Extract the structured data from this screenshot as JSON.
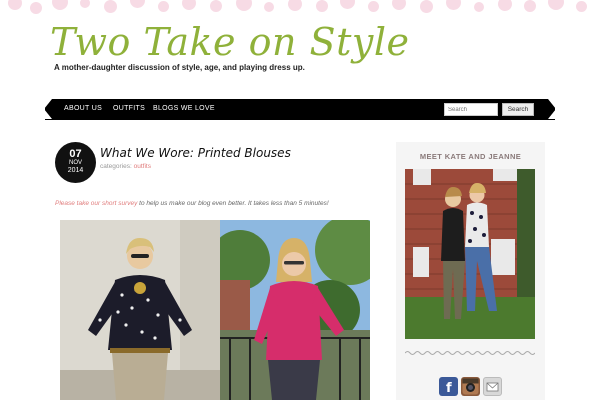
{
  "site": {
    "title": "Two Take on Style",
    "tagline": "A mother-daughter discussion of style, age, and playing dress up."
  },
  "nav": {
    "items": [
      {
        "label": "ABOUT US"
      },
      {
        "label": "OUTFITS"
      },
      {
        "label": "BLOGS WE LOVE"
      }
    ],
    "search_placeholder": "Search",
    "search_button": "Search"
  },
  "post": {
    "date": {
      "day": "07",
      "month": "NOV",
      "year": "2014"
    },
    "title": "What We Wore: Printed Blouses",
    "category_label": "categories:",
    "category": "outfits",
    "intro_link": "Please take our short survey",
    "intro_rest": " to help us make our blog even better. It takes less than 5 minutes!"
  },
  "sidebar": {
    "title": "MEET KATE AND JEANNE",
    "social_icons": [
      "facebook-icon",
      "instagram-icon",
      "email-icon"
    ]
  },
  "colors": {
    "accent_green": "#8fb13a",
    "link_pink": "#e07d7d",
    "nav_bg": "#000000",
    "dots_pink": "#f7dbe5"
  }
}
